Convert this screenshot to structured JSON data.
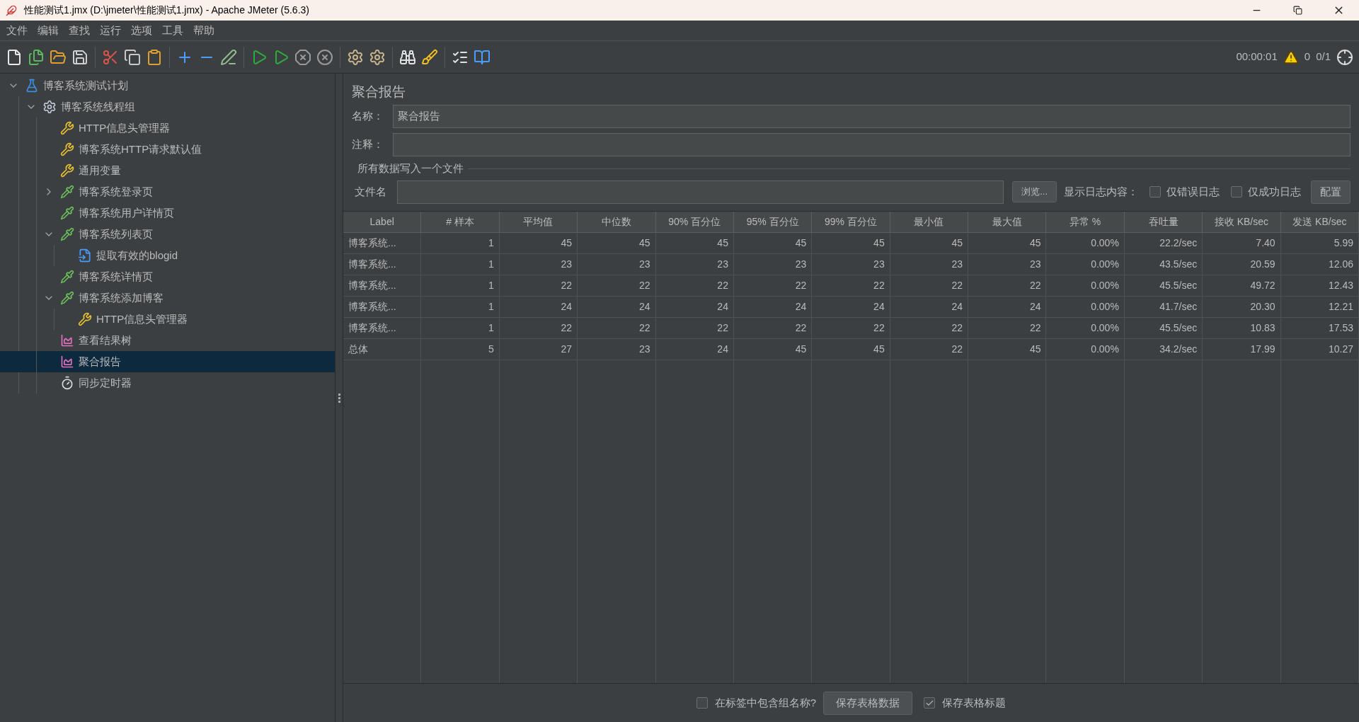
{
  "window": {
    "title": "性能测试1.jmx (D:\\jmeter\\性能测试1.jmx) - Apache JMeter (5.6.3)"
  },
  "menu": [
    "文件",
    "编辑",
    "查找",
    "运行",
    "选项",
    "工具",
    "帮助"
  ],
  "status": {
    "time": "00:00:01",
    "warnings": "0",
    "threads": "0/1"
  },
  "tree": [
    {
      "label": "博客系统测试计划",
      "kind": "plan",
      "expanded": true,
      "selected": false,
      "children": [
        {
          "label": "博客系统线程组",
          "kind": "threads",
          "expanded": true,
          "selected": false,
          "children": [
            {
              "label": "HTTP信息头管理器",
              "kind": "config",
              "selected": false
            },
            {
              "label": "博客系统HTTP请求默认值",
              "kind": "config",
              "selected": false
            },
            {
              "label": "通用变量",
              "kind": "config",
              "selected": false
            },
            {
              "label": "博客系统登录页",
              "kind": "sampler",
              "expanded": false,
              "selected": false
            },
            {
              "label": "博客系统用户详情页",
              "kind": "sampler",
              "selected": false
            },
            {
              "label": "博客系统列表页",
              "kind": "sampler",
              "expanded": true,
              "selected": false,
              "children": [
                {
                  "label": "提取有效的blogid",
                  "kind": "extractor",
                  "selected": false
                }
              ]
            },
            {
              "label": "博客系统详情页",
              "kind": "sampler",
              "selected": false
            },
            {
              "label": "博客系统添加博客",
              "kind": "sampler",
              "expanded": true,
              "selected": false,
              "children": [
                {
                  "label": "HTTP信息头管理器",
                  "kind": "config",
                  "selected": false
                }
              ]
            },
            {
              "label": "查看结果树",
              "kind": "listener",
              "selected": false
            },
            {
              "label": "聚合报告",
              "kind": "listener",
              "selected": true
            },
            {
              "label": "同步定时器",
              "kind": "timer",
              "selected": false
            }
          ]
        }
      ]
    }
  ],
  "panel": {
    "title": "聚合报告",
    "name_label": "名称：",
    "name_value": "聚合报告",
    "comment_label": "注释：",
    "file_section": "所有数据写入一个文件",
    "file_label": "文件名",
    "browse_button": "浏览...",
    "log_label": "显示日志内容：",
    "log_options": [
      {
        "label": "仅错误日志",
        "checked": false
      },
      {
        "label": "仅成功日志",
        "checked": false
      }
    ],
    "config_button": "配置"
  },
  "table": {
    "columns": [
      "Label",
      "# 样本",
      "平均值",
      "中位数",
      "90% 百分位",
      "95% 百分位",
      "99% 百分位",
      "最小值",
      "最大值",
      "异常 %",
      "吞吐量",
      "接收 KB/sec",
      "发送 KB/sec"
    ],
    "rows": [
      [
        "博客系统...",
        "1",
        "45",
        "45",
        "45",
        "45",
        "45",
        "45",
        "45",
        "0.00%",
        "22.2/sec",
        "7.40",
        "5.99"
      ],
      [
        "博客系统...",
        "1",
        "23",
        "23",
        "23",
        "23",
        "23",
        "23",
        "23",
        "0.00%",
        "43.5/sec",
        "20.59",
        "12.06"
      ],
      [
        "博客系统...",
        "1",
        "22",
        "22",
        "22",
        "22",
        "22",
        "22",
        "22",
        "0.00%",
        "45.5/sec",
        "49.72",
        "12.43"
      ],
      [
        "博客系统...",
        "1",
        "24",
        "24",
        "24",
        "24",
        "24",
        "24",
        "24",
        "0.00%",
        "41.7/sec",
        "20.30",
        "12.21"
      ],
      [
        "博客系统...",
        "1",
        "22",
        "22",
        "22",
        "22",
        "22",
        "22",
        "22",
        "0.00%",
        "45.5/sec",
        "10.83",
        "17.53"
      ],
      [
        "总体",
        "5",
        "27",
        "23",
        "24",
        "45",
        "45",
        "22",
        "45",
        "0.00%",
        "34.2/sec",
        "17.99",
        "10.27"
      ]
    ]
  },
  "footer": {
    "group_name": {
      "label": "在标签中包含组名称?",
      "checked": false
    },
    "save_button": "保存表格数据",
    "save_header": {
      "label": "保存表格标题",
      "checked": true
    }
  }
}
